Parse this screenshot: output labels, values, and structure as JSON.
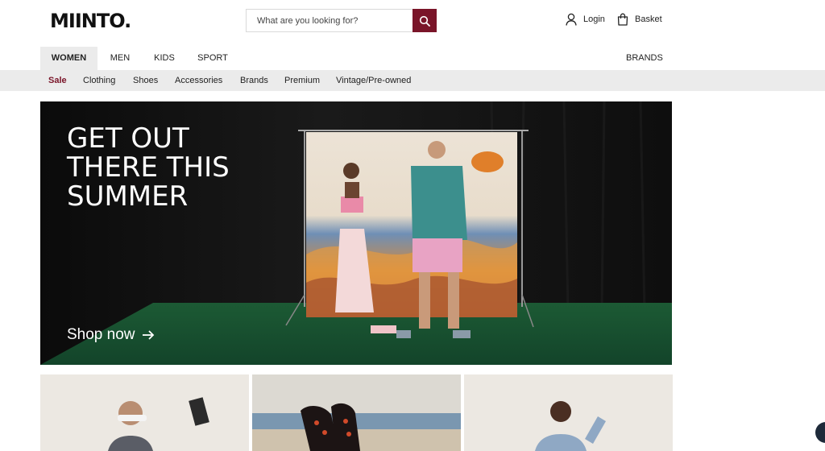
{
  "header": {
    "logo": "MIINTO.",
    "search_placeholder": "What are you looking for?",
    "login_label": "Login",
    "basket_label": "Basket"
  },
  "main_nav": {
    "tabs": [
      {
        "label": "WOMEN",
        "active": true
      },
      {
        "label": "MEN",
        "active": false
      },
      {
        "label": "KIDS",
        "active": false
      },
      {
        "label": "SPORT",
        "active": false
      }
    ],
    "brands_label": "BRANDS"
  },
  "sub_nav": {
    "items": [
      {
        "label": "Sale"
      },
      {
        "label": "Clothing"
      },
      {
        "label": "Shoes"
      },
      {
        "label": "Accessories"
      },
      {
        "label": "Brands"
      },
      {
        "label": "Premium"
      },
      {
        "label": "Vintage/Pre-owned"
      }
    ]
  },
  "hero": {
    "title_lines": [
      "GET OUT",
      "THERE THIS",
      "SUMMER"
    ],
    "cta_label": "Shop now"
  },
  "colors": {
    "accent": "#7a1529",
    "nav_bg": "#ebebeb",
    "hero_bg": "#121212"
  },
  "icons": {
    "search": "search-icon",
    "login": "user-icon",
    "basket": "bag-icon",
    "cta": "arrow-right-icon"
  }
}
